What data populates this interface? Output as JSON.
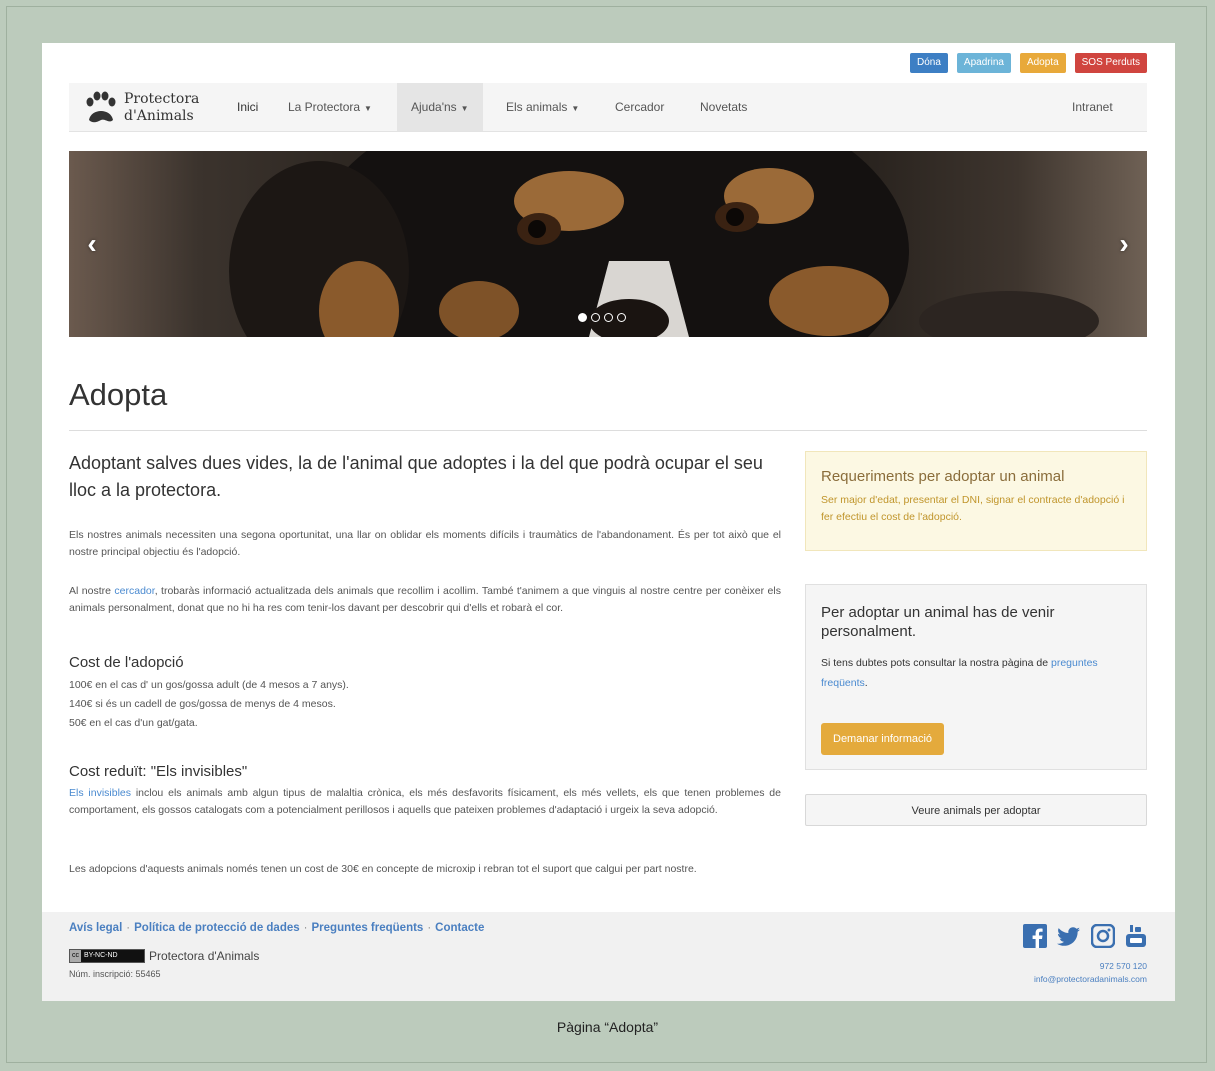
{
  "top_buttons": {
    "dona": "Dóna",
    "apadrina": "Apadrina",
    "adopta": "Adopta",
    "sos": "SOS Perduts"
  },
  "logo": {
    "line1": "Protectora",
    "line2": "d'Animals"
  },
  "nav": {
    "inici": "Inici",
    "protectora": "La Protectora",
    "ajudans": "Ajuda'ns",
    "animals": "Els animals",
    "cercador": "Cercador",
    "novetats": "Novetats",
    "intranet": "Intranet"
  },
  "carousel": {
    "prev": "‹",
    "next": "›",
    "slides": 4,
    "active": 1
  },
  "page_title": "Adopta",
  "lead": "Adoptant salves dues vides, la de l'animal que adoptes i la del que podrà ocupar el seu lloc a la protectora.",
  "para1": "Els nostres animals necessiten una segona oportunitat, una llar on oblidar els moments difícils i traumàtics de l'abandonament. És per tot això que el nostre principal objectiu és l'adopció.",
  "para2": {
    "before": "Al nostre ",
    "link": "cercador",
    "after": ", trobaràs informació actualitzada dels animals que recollim i acollim. També t'animem a que vinguis al nostre centre per conèixer els animals personalment, donat que no hi ha res com tenir-los davant per descobrir qui d'ells et robarà el cor."
  },
  "cost": {
    "title": "Cost de l'adopció",
    "lines": [
      "100€ en el cas d' un gos/gossa adult (de 4 mesos a 7 anys).",
      "140€ si és un cadell de gos/gossa de menys de 4 mesos.",
      "50€ en el cas d'un gat/gata."
    ]
  },
  "reduced": {
    "title": "Cost reduït: \"Els invisibles\"",
    "link": "Els invisibles",
    "text": " inclou els animals amb algun tipus de malaltia crònica, els més desfavorits físicament, els més vellets, els que tenen problemes de comportament, els gossos catalogats com a potencialment perillosos i aquells que pateixen problemes d'adaptació i urgeix la seva adopció.",
    "para": "Les adopcions d'aquests animals només tenen un cost de 30€ en concepte de microxip i rebran tot el suport que calgui per part nostre."
  },
  "alert": {
    "title": "Requeriments per adoptar un animal",
    "body": "Ser major d'edat, presentar el DNI, signar el contracte d'adopció i fer efectiu el cost de l'adopció."
  },
  "panel": {
    "title": "Per adoptar un animal has de venir personalment.",
    "body": "Si tens dubtes pots consultar la nostra pàgina de ",
    "link": "preguntes freqüents",
    "tail": ".",
    "button": "Demanar informació"
  },
  "veure_button": "Veure animals per adoptar",
  "footer": {
    "links": [
      "Avís legal",
      "Política de protecció de dades",
      "Preguntes freqüents",
      "Contacte"
    ],
    "separator": "·",
    "cc_badge_left": "cc",
    "cc_badge_right": "BY-NC-ND",
    "org": "Protectora d'Animals",
    "inscripcio": "Núm. inscripció: 55465",
    "phone": "972 570 120",
    "email": "info@protectoradanimals.com"
  },
  "caption": "Pàgina “Adopta”",
  "colors": {
    "background": "#bccbbc",
    "link": "#4a8ad0",
    "dona": "#3d7fc4",
    "apadrina": "#6cb4d8",
    "adopta": "#e8a93a",
    "sos": "#d0453f",
    "alert_bg": "#fcf8e3",
    "button_orange": "#e4aa3c"
  },
  "icons": [
    "paw-icon",
    "facebook-icon",
    "twitter-icon",
    "instagram-icon",
    "youtube-icon"
  ]
}
